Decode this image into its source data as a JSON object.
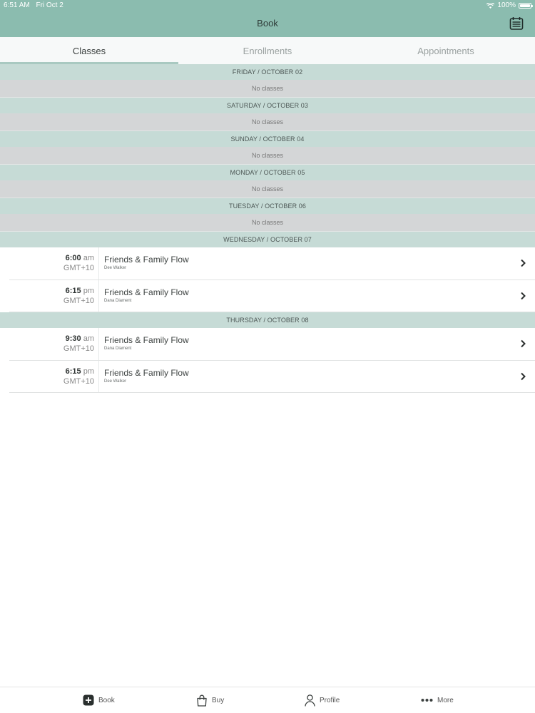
{
  "status": {
    "time": "6:51 AM",
    "date": "Fri Oct 2",
    "battery": "100%"
  },
  "header": {
    "title": "Book"
  },
  "tabs": [
    {
      "label": "Classes",
      "active": true
    },
    {
      "label": "Enrollments",
      "active": false
    },
    {
      "label": "Appointments",
      "active": false
    }
  ],
  "days": [
    {
      "header": "FRIDAY / OCTOBER 02",
      "empty": "No classes"
    },
    {
      "header": "SATURDAY / OCTOBER 03",
      "empty": "No classes"
    },
    {
      "header": "SUNDAY / OCTOBER 04",
      "empty": "No classes"
    },
    {
      "header": "MONDAY / OCTOBER 05",
      "empty": "No classes"
    },
    {
      "header": "TUESDAY / OCTOBER 06",
      "empty": "No classes"
    },
    {
      "header": "WEDNESDAY / OCTOBER 07",
      "classes": [
        {
          "time": "6:00",
          "ampm": "am",
          "tz": "GMT+10",
          "name": "Friends & Family Flow",
          "instructor": "Dee Walker"
        },
        {
          "time": "6:15",
          "ampm": "pm",
          "tz": "GMT+10",
          "name": "Friends & Family Flow",
          "instructor": "Dana Diament"
        }
      ]
    },
    {
      "header": "THURSDAY / OCTOBER 08",
      "classes": [
        {
          "time": "9:30",
          "ampm": "am",
          "tz": "GMT+10",
          "name": "Friends & Family Flow",
          "instructor": "Dana Diament"
        },
        {
          "time": "6:15",
          "ampm": "pm",
          "tz": "GMT+10",
          "name": "Friends & Family Flow",
          "instructor": "Dee Walker"
        }
      ]
    }
  ],
  "tabbar": [
    {
      "label": "Book",
      "icon": "plus-square-icon"
    },
    {
      "label": "Buy",
      "icon": "shopping-bag-icon"
    },
    {
      "label": "Profile",
      "icon": "person-icon"
    },
    {
      "label": "More",
      "icon": "more-dots-icon"
    }
  ],
  "colors": {
    "header": "#8bbcaf",
    "day_header": "#c6dbd6",
    "empty_row": "#d4d6d7",
    "tab_indicator": "#a9c9c1"
  }
}
